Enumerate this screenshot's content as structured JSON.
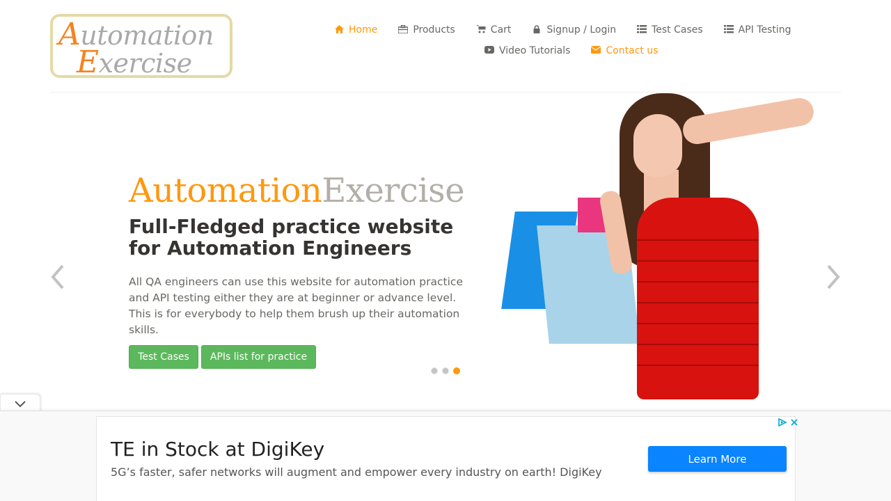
{
  "logo": {
    "line1_cap": "A",
    "line1_rest": "utomation",
    "line2_cap": "E",
    "line2_rest": "xercise"
  },
  "nav": {
    "items": [
      {
        "label": "Home",
        "icon": "home-icon",
        "active": true
      },
      {
        "label": "Products",
        "icon": "briefcase-icon"
      },
      {
        "label": "Cart",
        "icon": "cart-icon"
      },
      {
        "label": "Signup / Login",
        "icon": "lock-icon"
      },
      {
        "label": "Test Cases",
        "icon": "list-icon"
      },
      {
        "label": "API Testing",
        "icon": "list-icon"
      },
      {
        "label": "Video Tutorials",
        "icon": "youtube-play-icon"
      },
      {
        "label": "Contact us",
        "icon": "envelope-icon",
        "active": true
      }
    ]
  },
  "slider": {
    "brand_part1": "Automation",
    "brand_part2": "Exercise",
    "headline": "Full-Fledged practice website for Automation Engineers",
    "description": "All QA engineers can use this website for automation practice and API testing either they are at beginner or advance level. This is for everybody to help them brush up their automation skills.",
    "btn_test_cases": "Test Cases",
    "btn_apis": "APIs list for practice",
    "slide_count": 3,
    "active_slide": 3,
    "prev_glyph": "‹",
    "next_glyph": "›"
  },
  "ad": {
    "title": "TE in Stock at DigiKey",
    "subtitle": "5G’s faster, safer networks will augment and empower every industry on earth! DigiKey",
    "button": "Learn More"
  },
  "colors": {
    "accent": "#fe980f",
    "button_green": "#5cb85c",
    "ad_button": "#0a84ff"
  }
}
